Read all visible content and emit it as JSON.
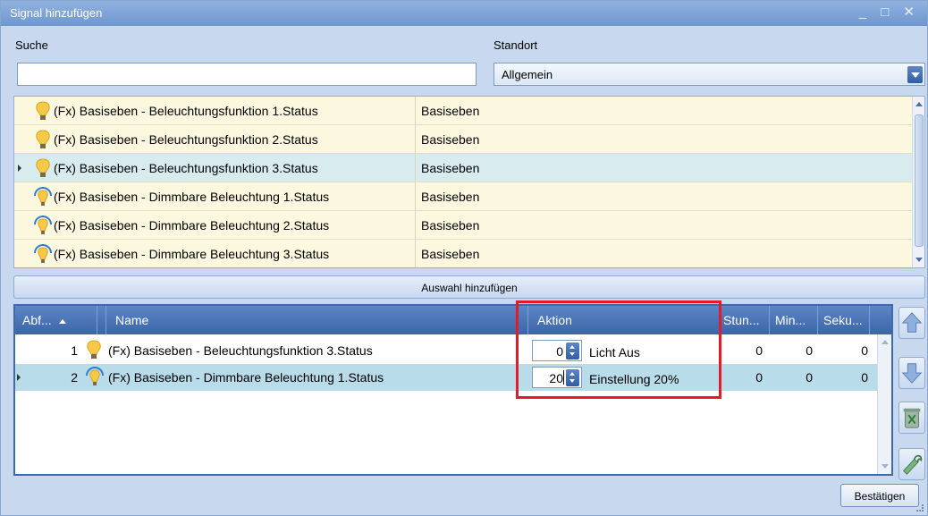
{
  "window": {
    "title": "Signal hinzufügen",
    "controls": "_ □ ✕"
  },
  "search": {
    "label": "Suche",
    "value": ""
  },
  "location": {
    "label": "Standort",
    "value": "Allgemein"
  },
  "signals": [
    {
      "name": "(Fx) Basiseben - Beleuchtungsfunktion 1.Status",
      "category": "Basiseben",
      "icon": "bulb-icon"
    },
    {
      "name": "(Fx) Basiseben - Beleuchtungsfunktion 2.Status",
      "category": "Basiseben",
      "icon": "bulb-icon"
    },
    {
      "name": "(Fx) Basiseben - Beleuchtungsfunktion 3.Status",
      "category": "Basiseben",
      "icon": "bulb-icon",
      "selected": true
    },
    {
      "name": "(Fx) Basiseben - Dimmbare Beleuchtung 1.Status",
      "category": "Basiseben",
      "icon": "dimmable-bulb-icon"
    },
    {
      "name": "(Fx) Basiseben - Dimmbare Beleuchtung 2.Status",
      "category": "Basiseben",
      "icon": "dimmable-bulb-icon"
    },
    {
      "name": "(Fx) Basiseben - Dimmbare Beleuchtung 3.Status",
      "category": "Basiseben",
      "icon": "dimmable-bulb-icon"
    }
  ],
  "add_button": "Auswahl hinzufügen",
  "grid": {
    "headers": {
      "order": "Abf...",
      "name": "Name",
      "action": "Aktion",
      "hours": "Stun...",
      "minutes": "Min...",
      "seconds": "Seku..."
    },
    "rows": [
      {
        "order": "1",
        "name": "(Fx) Basiseben - Beleuchtungsfunktion 3.Status",
        "icon": "bulb-icon",
        "action_value": "0",
        "action_text": "Licht Aus",
        "hours": "0",
        "minutes": "0",
        "seconds": "0"
      },
      {
        "order": "2",
        "name": "(Fx) Basiseben - Dimmbare Beleuchtung 1.Status",
        "icon": "dimmable-bulb-icon",
        "action_value": "20",
        "action_text": "Einstellung 20%",
        "hours": "0",
        "minutes": "0",
        "seconds": "0",
        "selected": true
      }
    ]
  },
  "side_buttons": [
    "move-up-icon",
    "move-down-icon",
    "delete-icon",
    "edit-icon"
  ],
  "confirm_label": "Bestätigen",
  "colors": {
    "titlebar": "#7aa0d6",
    "header": "#4a74b6",
    "highlight": "#e21b26",
    "row_selected": "#b9dcea"
  }
}
